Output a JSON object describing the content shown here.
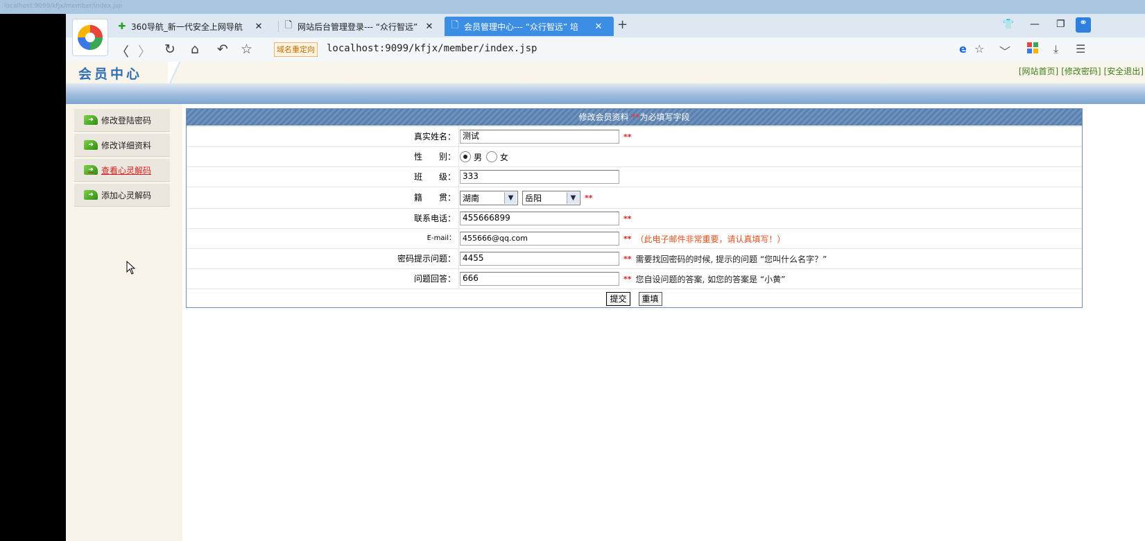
{
  "os_strip": {
    "text": "localhost:9099/kfjx/member/index.jsp"
  },
  "browser": {
    "tabs": [
      {
        "label": "360导航_新一代安全上网导航",
        "icon": "shield-nav-icon",
        "active": false
      },
      {
        "label": "网站后台管理登录--- “众行智远”",
        "icon": "document-icon",
        "active": false
      },
      {
        "label": "会员管理中心--- “众行智远” 培",
        "icon": "document-icon",
        "active": true
      }
    ],
    "new_tab": "+",
    "domain_badge": "域名重定向",
    "url": "localhost:9099/kfjx/member/index.jsp"
  },
  "header": {
    "title": "会员中心",
    "links": [
      "[网站首页]",
      "[修改密码]",
      "[安全退出]"
    ]
  },
  "sidebar": {
    "items": [
      {
        "label": "修改登陆密码",
        "active": false
      },
      {
        "label": "修改详细资料",
        "active": false
      },
      {
        "label": "查看心灵解码",
        "active": true
      },
      {
        "label": "添加心灵解码",
        "active": false
      }
    ]
  },
  "form": {
    "title": "修改会员资料",
    "title_star": "**",
    "title_suffix": "为必填写字段",
    "fields": {
      "name": {
        "label": "真实姓名：",
        "value": "测试",
        "req": "**"
      },
      "gender": {
        "label": "性　　别：",
        "opt_male": "男",
        "opt_female": "女",
        "selected": "男"
      },
      "class": {
        "label": "班　　级：",
        "value": "333"
      },
      "origin": {
        "label": "籍　　贯：",
        "province": "湖南",
        "city": "岳阳",
        "req": "**"
      },
      "phone": {
        "label": "联系电话：",
        "value": "455666899",
        "req": "**"
      },
      "email": {
        "label": "E-mail：",
        "value": "455666@qq.com",
        "req": "**",
        "hint": "（此电子邮件非常重要，请认真填写！）"
      },
      "question": {
        "label": "密码提示问题：",
        "value": "4455",
        "req": "**",
        "hint": "需要找回密码的时候, 提示的问题 “您叫什么名字？”"
      },
      "answer": {
        "label": "问题回答：",
        "value": "666",
        "req": "**",
        "hint": "您自设问题的答案, 如您的答案是 “小黄”"
      }
    },
    "submit": "提交",
    "reset": "重填"
  },
  "colors": {
    "accent": "#3b8ee4",
    "required": "#e0201e",
    "link_green": "#3d7d1c",
    "header_blue": "#5b80ad"
  }
}
